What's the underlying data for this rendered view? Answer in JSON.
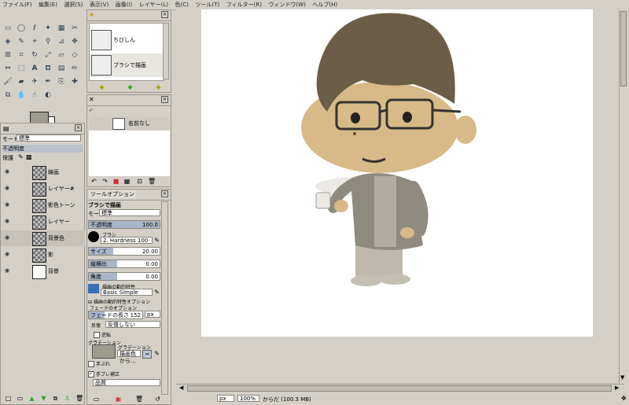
{
  "menubar": {
    "items": [
      "ファイル(F)",
      "編集(E)",
      "選択(S)",
      "表示(V)",
      "画像(I)",
      "レイヤー(L)",
      "色(C)",
      "ツール(T)",
      "フィルター(R)",
      "ウィンドウ(W)",
      "ヘルプ(H)"
    ]
  },
  "colors": {
    "foreground": "#9e9a8e",
    "background": "#ffffff"
  },
  "brush_panel": {
    "items": [
      "ちびしん",
      "ブラシで描画"
    ]
  },
  "history_panel": {
    "item": "名前なし"
  },
  "layers_panel": {
    "mode_label": "モード",
    "mode_value": "標準",
    "opacity_label": "不透明度",
    "lock_label": "保護",
    "layers": [
      "線画",
      "レイヤー#",
      "影色トーン",
      "レイヤー",
      "背景色",
      "影",
      "背景"
    ]
  },
  "tool_options": {
    "tab_label": "ツールオプション",
    "title": "ブラシで描画",
    "mode_label": "モード",
    "mode_value": "標準",
    "opacity_label": "不透明度",
    "opacity_value": "100.0",
    "brush_label": "ブラシ",
    "brush_name": "2. Hardness 100",
    "size_label": "サイズ",
    "size_value": "20.00",
    "aspect_label": "縦横比",
    "aspect_value": "0.00",
    "angle_label": "角度",
    "angle_value": "0.00",
    "dynamics_label": "描画の動的特性",
    "dynamics_value": "Basic Simple",
    "dynamics_options_label": "描画の動的特性オプション",
    "fade_options_label": "フェードのオプション",
    "fade_length_label": "フェードの長さ",
    "fade_length_value": "152",
    "fade_unit": "px",
    "repeat_label": "反復",
    "repeat_value": "反復しない",
    "reverse_label": "逆転",
    "gradient_label": "グラデーション",
    "gradient_name": "描画色から...",
    "jitter_label": "手ぶれ",
    "smooth_label": "手ブレ補正",
    "bottom_mode": "品質"
  },
  "status": {
    "unit": "px",
    "zoom": "100%",
    "info": "からだ (100.3 MB)"
  }
}
